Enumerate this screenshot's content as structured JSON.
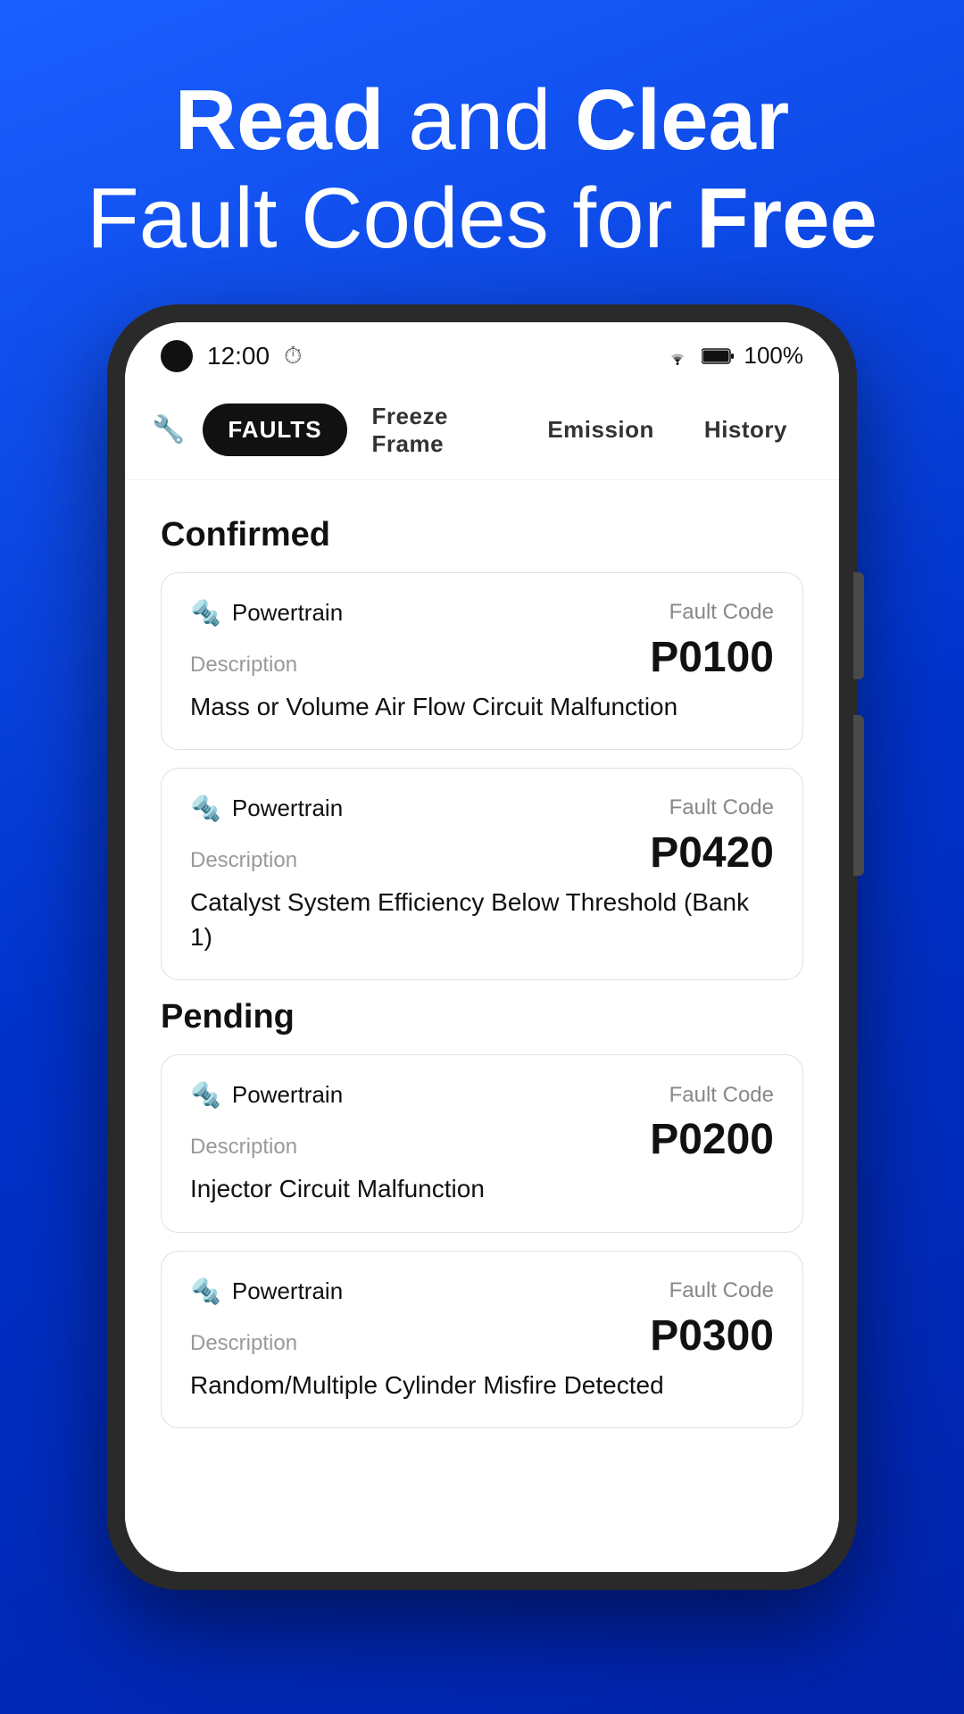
{
  "hero": {
    "line1_normal": "and ",
    "line1_bold1": "Read",
    "line1_bold2": "Clear",
    "line2_normal": "Fault Codes for ",
    "line2_bold": "Free"
  },
  "status_bar": {
    "time": "12:00",
    "battery": "100%"
  },
  "tabs": [
    {
      "label": "Faults",
      "active": true
    },
    {
      "label": "Freeze Frame",
      "active": false
    },
    {
      "label": "Emission",
      "active": false
    },
    {
      "label": "History",
      "active": false
    }
  ],
  "sections": [
    {
      "title": "Confirmed",
      "cards": [
        {
          "system": "Powertrain",
          "fault_code_label": "Fault Code",
          "description_label": "Description",
          "fault_code": "P0100",
          "description": "Mass or Volume Air Flow Circuit Malfunction"
        },
        {
          "system": "Powertrain",
          "fault_code_label": "Fault Code",
          "description_label": "Description",
          "fault_code": "P0420",
          "description": "Catalyst System Efficiency Below Threshold (Bank 1)"
        }
      ]
    },
    {
      "title": "Pending",
      "cards": [
        {
          "system": "Powertrain",
          "fault_code_label": "Fault Code",
          "description_label": "Description",
          "fault_code": "P0200",
          "description": "Injector Circuit Malfunction"
        },
        {
          "system": "Powertrain",
          "fault_code_label": "Fault Code",
          "description_label": "Description",
          "fault_code": "P0300",
          "description": "Random/Multiple Cylinder Misfire Detected"
        }
      ]
    }
  ]
}
